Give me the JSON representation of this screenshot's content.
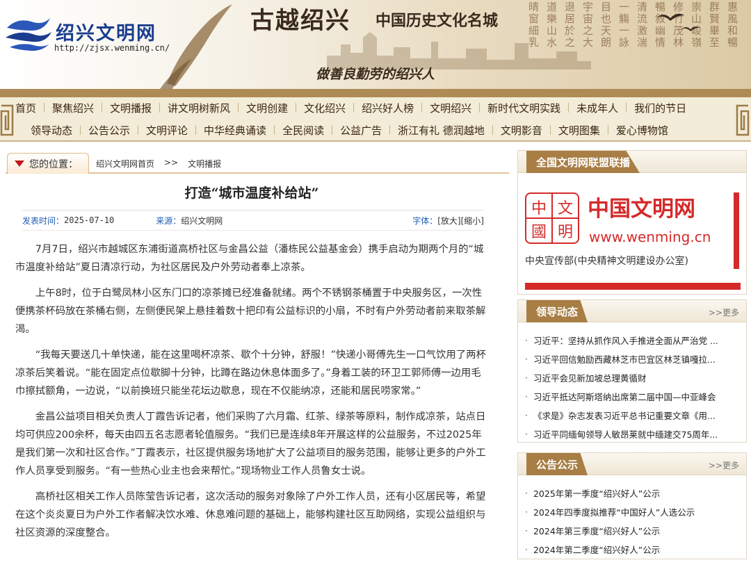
{
  "header": {
    "logo_name": "绍兴文明网",
    "logo_url": "http://zjsx.wenming.cn/",
    "city_title": "古越绍兴",
    "city_subtitle": "中国历史文化名城",
    "slogan": "做善良勤劳的绍兴人",
    "colors": {
      "brand_blue": "#1a3d8f",
      "accent_brown": "#ae8a55",
      "red": "#c0171c"
    }
  },
  "nav": {
    "row1": [
      "首页",
      "聚焦绍兴",
      "文明播报",
      "讲文明树新风",
      "文明创建",
      "文化绍兴",
      "绍兴好人榜",
      "文明绍兴",
      "新时代文明实践",
      "未成年人",
      "我们的节日"
    ],
    "row2": [
      "领导动态",
      "公告公示",
      "文明评论",
      "中华经典诵读",
      "全民阅读",
      "公益广告",
      "浙江有礼 德润越地",
      "文明影音",
      "文明图集",
      "爱心博物馆"
    ]
  },
  "breadcrumb": {
    "label": "您的位置：",
    "home": "绍兴文明网首页",
    "sep": ">>",
    "current": "文明播报"
  },
  "article": {
    "title": "打造“城市温度补给站”",
    "date_label": "发表时间：",
    "date": "2025-07-10",
    "source_label": "来源：",
    "source": "绍兴文明网",
    "font_label": "字体：",
    "font_large": "[放大]",
    "font_small": "[缩小]",
    "paragraphs": [
      "7月7日，绍兴市越城区东浦街道高桥社区与金昌公益（潘栋民公益基金会）携手启动为期两个月的“城市温度补给站”夏日清凉行动，为社区居民及户外劳动者奉上凉茶。",
      "上午8时，位于白鹭凤林小区东门口的凉茶摊已经准备就绪。两个不锈钢茶桶置于中央服务区，一次性便携茶杯码放在茶桶右侧，左侧便民架上悬挂着数十把印有公益标识的小扇，不时有户外劳动者前来取茶解渴。",
      "“我每天要送几十单快递，能在这里喝杯凉茶、歇个十分钟，舒服！”快递小哥傅先生一口气饮用了两杯凉茶后笑着说。“能在固定点位歇脚十分钟，比蹲在路边休息体面多了。”身着工装的环卫工郭师傅一边用毛巾擦拭额角，一边说，“以前换班只能坐花坛边歇息，现在不仅能纳凉，还能和居民唠家常。”",
      "金昌公益项目相关负责人丁霞告诉记者，他们采购了六月霜、红茶、绿茶等原料，制作成凉茶，站点日均可供应200余杯，每天由四五名志愿者轮值服务。“我们已是连续8年开展这样的公益服务，不过2025年是我们第一次和社区合作。”丁霞表示，社区提供服务场地扩大了公益项目的服务范围，能够让更多的户外工作人员享受到服务。“有一些热心业主也会来帮忙。”现场物业工作人员鲁女士说。",
      "高桥社区相关工作人员陈莹告诉记者，这次活动的服务对象除了户外工作人员，还有小区居民等，希望在这个炎炎夏日为户外工作者解决饮水难、休息难问题的基础上，能够构建社区互助网络，实现公益组织与社区资源的深度整合。"
    ]
  },
  "sidebar": {
    "alliance": {
      "title": "全国文明网联盟联播",
      "banner_cn": "中国文明网",
      "banner_url": "www.wenming.cn",
      "banner_dept": "中央宣传部(中央精神文明建设办公室)",
      "seal_text": [
        "中",
        "文",
        "國",
        "明"
      ]
    },
    "leaders": {
      "title": "领导动态",
      "more": ">>更多",
      "items": [
        "习近平：坚持从抓作风入手推进全面从严治党 ...",
        "习近平回信勉励西藏林芝市巴宜区林芝镇嘎拉...",
        "习近平会见新加坡总理黄循财",
        "习近平抵达阿斯塔纳出席第二届中国—中亚峰会",
        "《求是》杂志发表习近平总书记重要文章《用...",
        "习近平同缅甸领导人敏昂莱就中缅建交75周年..."
      ]
    },
    "notices": {
      "title": "公告公示",
      "more": ">>更多",
      "items": [
        "2025年第一季度“绍兴好人”公示",
        "2024年四季度拟推荐“中国好人”人选公示",
        "2024年第三季度“绍兴好人”公示",
        "2024年第二季度“绍兴好人”公示"
      ]
    }
  }
}
